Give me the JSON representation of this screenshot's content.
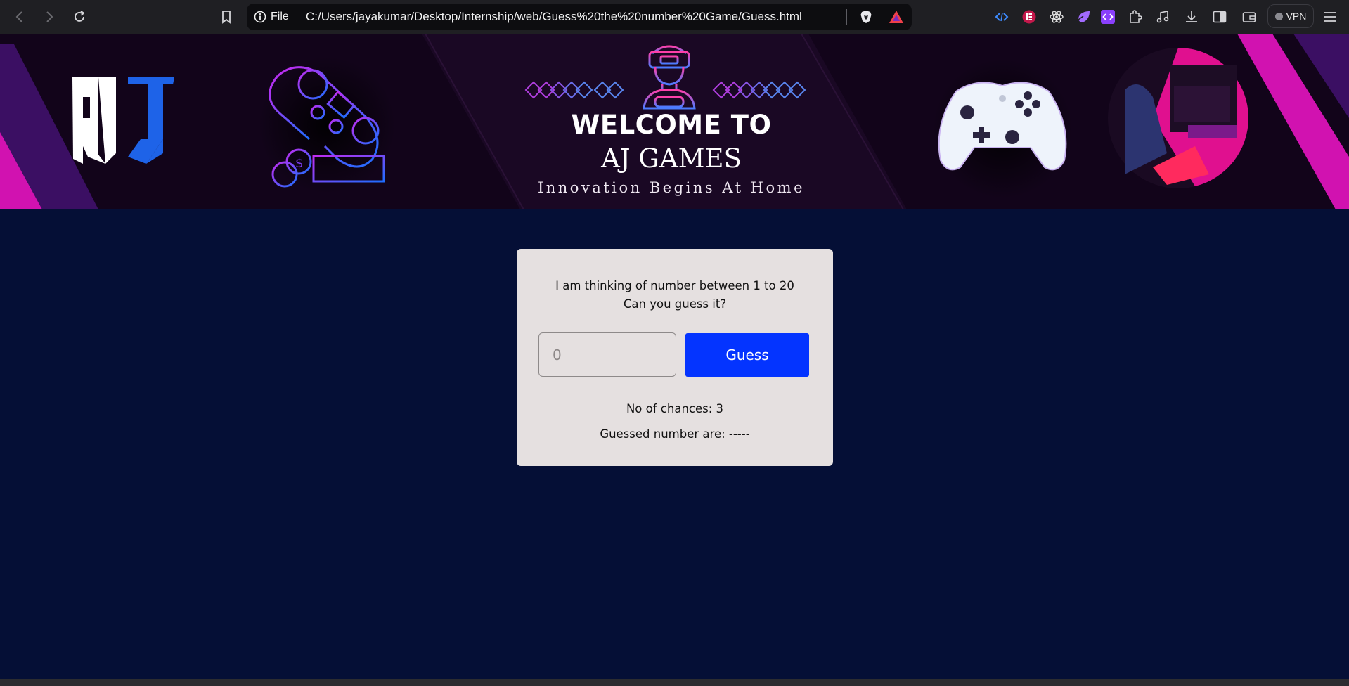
{
  "browser": {
    "url_scheme": "File",
    "url": "C:/Users/jayakumar/Desktop/Internship/web/Guess%20the%20number%20Game/Guess.html",
    "vpn_label": "VPN",
    "icons": [
      "back-icon",
      "forward-icon",
      "reload-icon",
      "bookmark-icon",
      "info-icon",
      "brave-shields-icon",
      "brave-rewards-icon",
      "code-extension-icon",
      "extension-red-icon",
      "react-devtools-icon",
      "extension-purple-icon",
      "extension-code-icon",
      "extensions-puzzle-icon",
      "music-icon",
      "download-icon",
      "sidebar-icon",
      "wallet-icon",
      "menu-icon"
    ]
  },
  "banner": {
    "logo": "AJ",
    "welcome": "WELCOME TO",
    "brand": "AJ GAMES",
    "tagline": "Innovation Begins At Home",
    "colors": {
      "background": "#12041a",
      "magenta": "#e10fb4",
      "purple": "#5a1a9e",
      "neon_blue": "#1f6dff"
    }
  },
  "game": {
    "prompt_line1": "I am thinking of number between 1 to 20",
    "prompt_line2": "Can you guess it?",
    "input_placeholder": "0",
    "guess_button": "Guess",
    "chances_text": "No of chances: 3",
    "guessed_text": "Guessed number are: -----",
    "colors": {
      "page_bg": "#050f36",
      "card_bg": "#e5e0e0",
      "button": "#0434ff"
    }
  }
}
